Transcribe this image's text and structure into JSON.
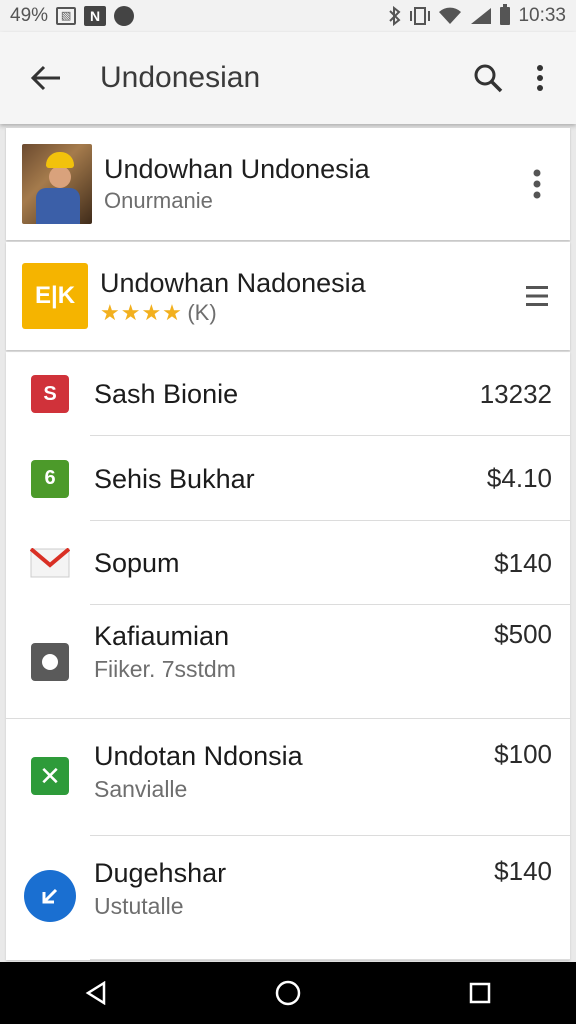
{
  "status_bar": {
    "battery_percent": "49%",
    "time": "10:33",
    "icons": [
      "image-icon",
      "app-n-icon",
      "circle-notification-icon",
      "bluetooth-icon",
      "vibrate-icon",
      "wifi-icon",
      "signal-icon",
      "battery-icon"
    ]
  },
  "app_bar": {
    "title": "Undonesian",
    "back_icon": "arrow-back-icon",
    "search_icon": "search-icon",
    "more_icon": "more-vert-icon"
  },
  "header_card": {
    "title": "Undowhan Undonesia",
    "subtitle": "Onurmanie"
  },
  "app_card": {
    "logo_text": "E|K",
    "title": "Undowhan Nadonesia",
    "stars": "★★★★",
    "rating_text": "(K)"
  },
  "items": [
    {
      "icon": "s-app-icon",
      "color": "#d0323a",
      "glyph": "S",
      "title": "Sash Bionie",
      "subtitle": "",
      "value": "13232"
    },
    {
      "icon": "six-app-icon",
      "color": "#4c9a2a",
      "glyph": "6",
      "title": "Sehis Bukhar",
      "subtitle": "",
      "value": "$4.10"
    },
    {
      "icon": "mail-icon",
      "color": "#d93025",
      "glyph": "",
      "title": "Sopum",
      "subtitle": "",
      "value": "$140"
    },
    {
      "icon": "camera-app-icon",
      "color": "#555555",
      "glyph": "",
      "title": "Kafiaumian",
      "subtitle": "Fiiker. 7sstdm",
      "value": "$500"
    },
    {
      "icon": "x-app-icon",
      "color": "#2e9b3a",
      "glyph": "✕",
      "title": "Undotan Ndonsia",
      "subtitle": "Sanvialle",
      "value": "$100"
    },
    {
      "icon": "download-app-icon",
      "color": "#1a6fd1",
      "glyph": "",
      "title": "Dugehshar",
      "subtitle": "Ustutalle",
      "value": "$140"
    }
  ],
  "nav_bar": {
    "back": "nav-back-icon",
    "home": "nav-home-icon",
    "recents": "nav-recents-icon"
  }
}
